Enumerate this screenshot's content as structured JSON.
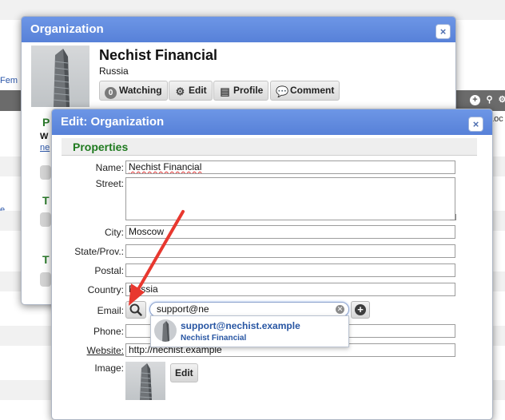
{
  "background": {
    "link_fem": "Fem",
    "link_e": "e",
    "col_loc": "Loc"
  },
  "org_dialog": {
    "title": "Organization",
    "close_label": "×",
    "name": "Nechist Financial",
    "country": "Russia",
    "buttons": {
      "watching_count": "0",
      "watching": "Watching",
      "edit": "Edit",
      "profile": "Profile",
      "comment": "Comment"
    },
    "underlay": {
      "section_p": "P",
      "text_w": "W",
      "text_ne": "ne",
      "section_t1": "T",
      "section_t2": "T"
    }
  },
  "edit_dialog": {
    "title": "Edit: Organization",
    "close_label": "×",
    "section": "Properties",
    "fields": {
      "name": {
        "label": "Name:",
        "value": "Nechist Financial"
      },
      "street": {
        "label": "Street:",
        "value": ""
      },
      "city": {
        "label": "City:",
        "value": "Moscow"
      },
      "state": {
        "label": "State/Prov.:",
        "value": ""
      },
      "postal": {
        "label": "Postal:",
        "value": ""
      },
      "country": {
        "label": "Country:",
        "value": "Russia"
      },
      "email": {
        "label": "Email:",
        "value": "support@ne"
      },
      "phone": {
        "label": "Phone:",
        "value": ""
      },
      "website": {
        "label": "Website:",
        "value": "http://nechist.example"
      },
      "image": {
        "label": "Image:"
      }
    },
    "image_edit_button": "Edit",
    "suggestion": {
      "email": "support@nechist.example",
      "org": "Nechist Financial"
    }
  },
  "colors": {
    "title_bar": "#5f89dc",
    "section_green": "#1f7a1f",
    "arrow_red": "#e8382f",
    "link_blue": "#2856a3"
  },
  "icons": [
    "close-icon",
    "gear-icon",
    "profile-card-icon",
    "comment-icon",
    "search-icon",
    "clear-icon",
    "plus-icon",
    "building-icon",
    "arrow-annotation"
  ]
}
